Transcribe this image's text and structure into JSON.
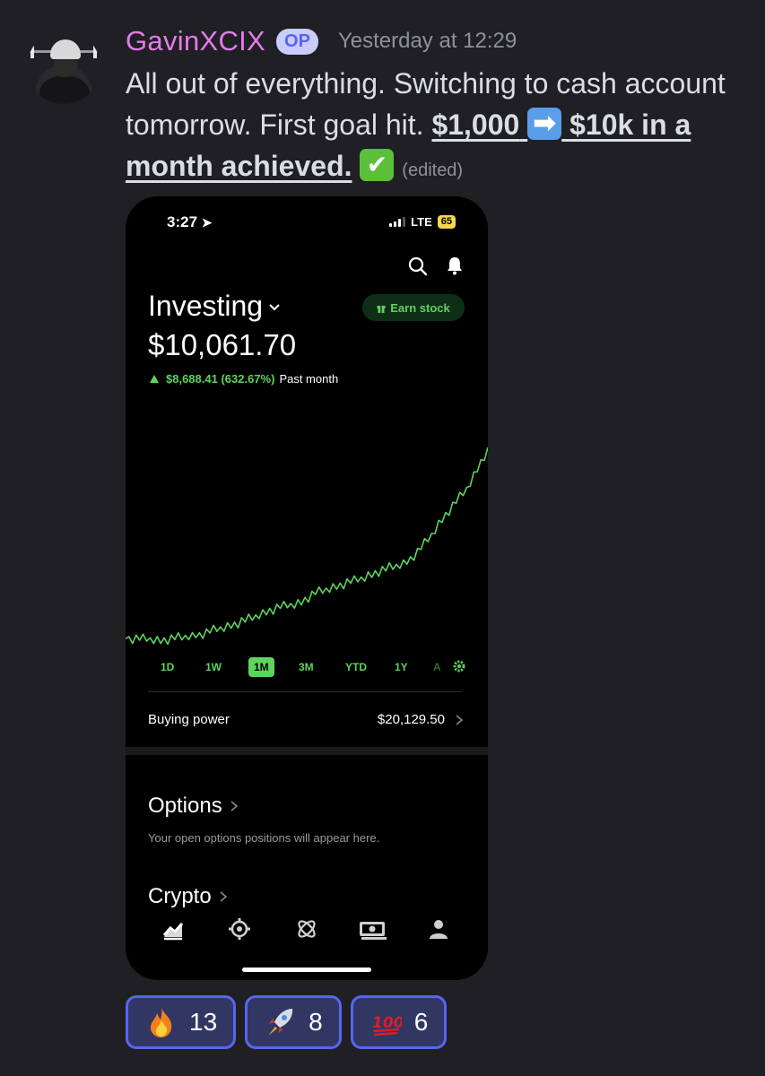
{
  "message": {
    "author": "GavinXCIX",
    "badge": "OP",
    "timestamp": "Yesterday at 12:29",
    "text_plain": "All out of everything. Switching to cash account tomorrow. First goal hit.",
    "text_bold_1": "$1,000",
    "text_bold_2": "$10k in a month achieved.",
    "edited_label": "(edited)",
    "emoji": [
      "right-arrow-emoji",
      "check-mark-emoji"
    ]
  },
  "phone": {
    "status": {
      "time": "3:27",
      "network": "LTE",
      "battery": "65"
    },
    "account_title": "Investing",
    "earn_label": "Earn stock",
    "portfolio_value": "$10,061.70",
    "change_amount": "$8,688.41 (632.67%)",
    "change_period": "Past month",
    "ranges": [
      "1D",
      "1W",
      "1M",
      "3M",
      "YTD",
      "1Y",
      "A"
    ],
    "active_range": "1M",
    "buying_power_label": "Buying power",
    "buying_power_value": "$20,129.50",
    "options_title": "Options",
    "options_sub": "Your open options positions will appear here.",
    "crypto_title": "Crypto",
    "tabs": [
      "investing-icon",
      "browse-icon",
      "crypto-icon",
      "cash-icon",
      "account-icon"
    ],
    "accent_color": "#5ed35d"
  },
  "reactions": [
    {
      "emoji": "fire-emoji",
      "count": "13"
    },
    {
      "emoji": "rocket-emoji",
      "count": "8"
    },
    {
      "emoji": "hundred-points-emoji",
      "count": "6"
    }
  ],
  "colors": {
    "background": "#1f1f24",
    "username": "#e47ce8",
    "badge_bg": "#c9cdfb",
    "reaction_border": "#5865f2"
  },
  "chart_data": {
    "type": "line",
    "series": [
      {
        "values": [
          1373,
          1360,
          1372,
          1365,
          1372,
          1355,
          1380,
          1362,
          1350,
          1330,
          1300,
          1310,
          1335,
          1360,
          1400,
          1420,
          1440,
          1470,
          1520,
          1500,
          1560,
          1540,
          1600,
          1640,
          1700,
          1760,
          1820,
          1860,
          1900,
          1950,
          1990,
          2020,
          2080,
          2150,
          2200,
          2260,
          2330,
          2400,
          2480,
          2540,
          2600,
          2650,
          2700,
          2760,
          2820,
          2840,
          2900,
          2920,
          2950,
          3000,
          3050,
          3150,
          3250,
          3350,
          3450,
          3500,
          3560,
          3620,
          3680,
          3720,
          3760,
          3800,
          3860,
          3920,
          3960,
          4000,
          4080,
          4120,
          4180,
          4260,
          4300,
          4360,
          4420,
          4480,
          4520,
          4600,
          4640,
          4700,
          4760,
          4800,
          4900,
          5000,
          5150,
          5300,
          5500,
          5700,
          5900,
          6100,
          6350,
          6600,
          6800,
          7000,
          7200,
          7400,
          7600,
          7800,
          8000,
          8200,
          8500,
          8800,
          9100,
          9400,
          9700,
          10061.7
        ]
      }
    ],
    "ylabel": "",
    "xlabel": ""
  }
}
